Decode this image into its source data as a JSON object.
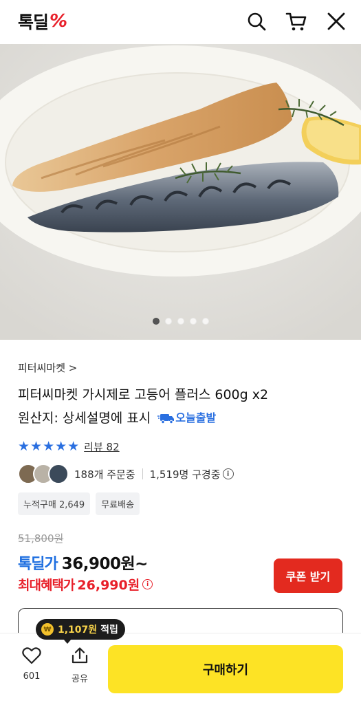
{
  "header": {
    "logo_text": "톡딜",
    "logo_symbol": "%",
    "icons": [
      "search-icon",
      "cart-icon",
      "close-icon"
    ]
  },
  "gallery": {
    "total_images": 5,
    "current_index": 1
  },
  "product": {
    "seller": "피터씨마켓 >",
    "title": "피터씨마켓 가시제로 고등어 플러스 600g x2",
    "origin": "원산지: 상세설명에 표시",
    "shipping_badge": "오늘출발",
    "rating_stars": "★★★★★",
    "rating_value": 5,
    "review_label": "리뷰 82",
    "orders_label": "188개 주문중",
    "viewers_label": "1,519명 구경중",
    "tags": [
      "누적구매 2,649",
      "무료배송"
    ]
  },
  "pricing": {
    "original_price": "51,800원",
    "tokdeal_label": "톡딜가",
    "tokdeal_price": "36,900원~",
    "max_benefit_label": "최대혜택가",
    "max_benefit_price": "26,990원",
    "coupon_button": "쿠폰 받기"
  },
  "points_tooltip": {
    "amount": "1,107원",
    "suffix": "적립"
  },
  "bottom_bar": {
    "like_count": "601",
    "share_label": "공유",
    "buy_button": "구매하기"
  },
  "colors": {
    "brand_red": "#e8202a",
    "accent_blue": "#1f6fe0",
    "buy_yellow": "#fde325",
    "coupon_red": "#e32a1f"
  }
}
